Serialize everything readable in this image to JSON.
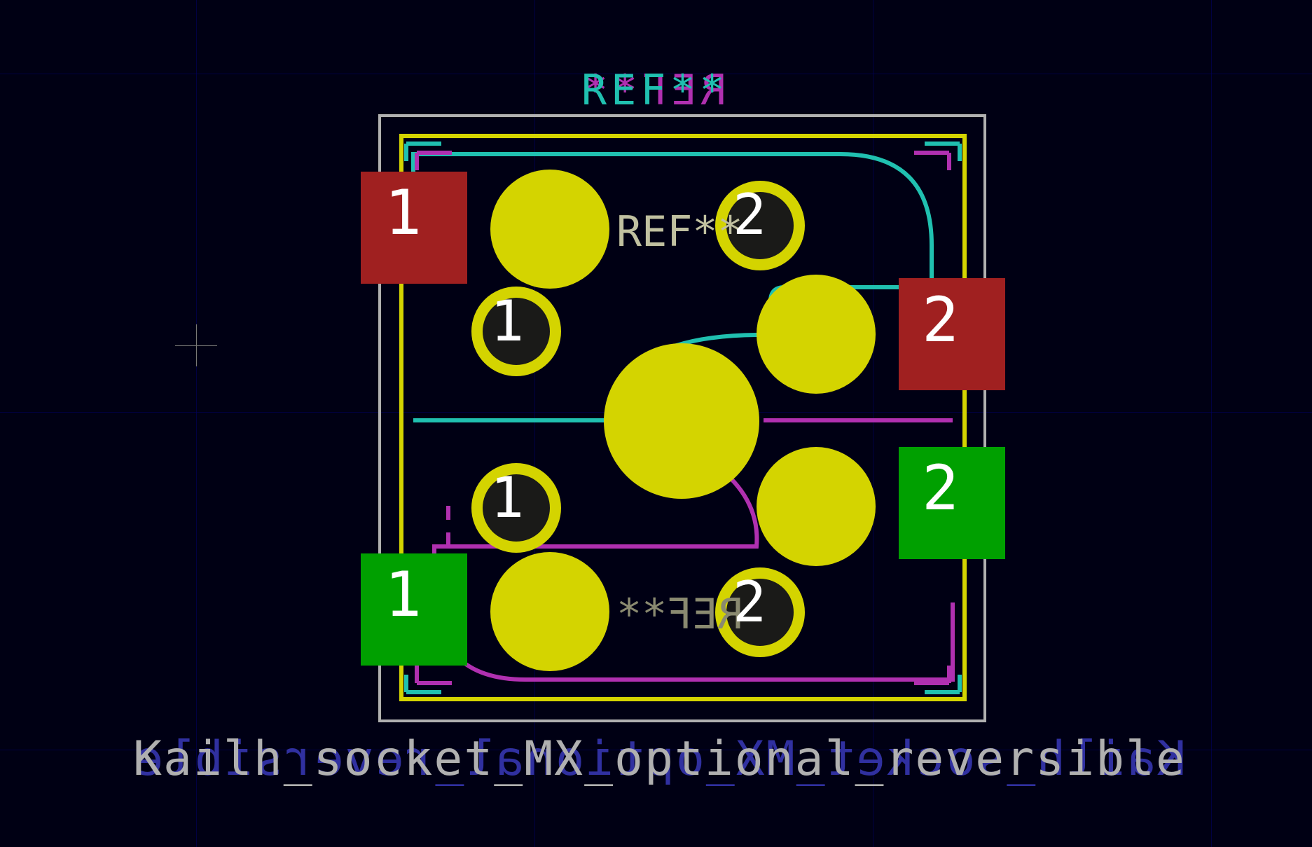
{
  "footprint": {
    "name": "Kailh_socket_MX_optional_reversible",
    "ref_front": "REF**",
    "ref_back": "REF**",
    "ref_fab_front": "REF**",
    "ref_fab_back": "REF**"
  },
  "pads": {
    "top_left_red": "1",
    "top_right_red": "2",
    "bottom_left_green": "1",
    "bottom_right_green": "2",
    "ring_upper_1": "1",
    "ring_upper_2": "2",
    "ring_lower_1": "1",
    "ring_lower_2": "2"
  },
  "colors": {
    "bg": "#000014",
    "grid": "#000060",
    "outline_gray": "#b0b0b0",
    "outline_yellow": "#d4d400",
    "pad_red": "#a02020",
    "pad_green": "#00a000",
    "hole": "#d4d400",
    "silk_teal": "#20c0b0",
    "silk_magenta": "#b030b0",
    "text_white": "#ffffff"
  }
}
